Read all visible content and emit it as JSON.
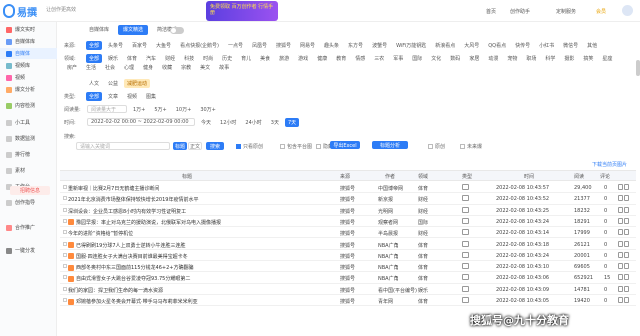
{
  "app": {
    "logo_text": "易撰",
    "tagline": "让创作更高效",
    "banner": "免费领取 百万创作者 行情手册"
  },
  "topnav": [
    {
      "label": "首页"
    },
    {
      "label": "创作助手"
    },
    {
      "label": "定制服务"
    },
    {
      "label": "会员"
    }
  ],
  "sidebar": {
    "items": [
      {
        "label": "爆文实时",
        "icon": "fire-icon"
      },
      {
        "label": "自媒体库",
        "icon": "db-icon"
      },
      {
        "label": "自媒体",
        "icon": "media-icon"
      },
      {
        "label": "视频库",
        "icon": "video-icon"
      },
      {
        "label": "视频",
        "icon": "play-icon"
      },
      {
        "label": "爆文分析",
        "icon": "chart-icon"
      },
      {
        "label": "内容检测",
        "icon": "check-icon"
      },
      {
        "label": "小工具",
        "icon": "tool-icon"
      },
      {
        "label": "数据监测",
        "icon": "monitor-icon"
      },
      {
        "label": "排行榜",
        "icon": "rank-icon"
      },
      {
        "label": "素材",
        "icon": "asset-icon"
      },
      {
        "label": "工作台",
        "icon": "desk-icon"
      },
      {
        "label": "创作指导",
        "icon": "guide-icon"
      },
      {
        "label": "合作推广",
        "icon": "promo-icon"
      },
      {
        "label": "一键分发",
        "icon": "send-icon"
      }
    ],
    "cta": "招聘信息"
  },
  "tabs": [
    {
      "label": "自媒体库"
    },
    {
      "label": "爆文精选"
    }
  ],
  "toggle_label": "简洁模式",
  "filters": {
    "source": {
      "label": "来源:",
      "chips": [
        "全部",
        "头条号",
        "百家号",
        "大鱼号",
        "看点快报(企鹅号)",
        "一点号",
        "凤凰号",
        "搜狐号",
        "网易号",
        "趣头条",
        "东方号",
        "波蟹号",
        "WiFi万能钥匙",
        "新浪看点",
        "大风号",
        "QQ看点",
        "快传号",
        "小红书",
        "微信号",
        "其他"
      ]
    },
    "domain": {
      "label": "领域:",
      "chips": [
        "全部",
        "娱乐",
        "体育",
        "汽车",
        "财经",
        "科技",
        "时尚",
        "历史",
        "育儿",
        "美食",
        "旅游",
        "游戏",
        "健康",
        "教育",
        "情感",
        "三农",
        "军事",
        "国际",
        "文化",
        "数码",
        "家居",
        "动漫",
        "宠物",
        "职场",
        "科学",
        "摄影",
        "搞笑",
        "星座",
        "房产",
        "生活",
        "社会",
        "心理",
        "健身",
        "收藏",
        "宗教",
        "美文",
        "故事"
      ]
    },
    "domain2": {
      "chips": [
        "人文",
        "公益",
        "减肥运动"
      ]
    },
    "media": {
      "label": "类型:",
      "chips": [
        "全部",
        "文章",
        "视频",
        "图集"
      ]
    },
    "read": {
      "label": "阅读量:",
      "placeholder": "阅读量大于",
      "chips": [
        "1万+",
        "5万+",
        "10万+",
        "30万+"
      ]
    },
    "time": {
      "label": "时间:",
      "from": "2022-02-02 00:00",
      "to": "2022-02-09 00:00",
      "chips": [
        "今天",
        "12小时",
        "24小时",
        "3天",
        "7天"
      ]
    },
    "search": {
      "label": "搜索:",
      "placeholder": "请输入关键词",
      "btn_title": "标题",
      "btn_content": "正文",
      "btn_search": "搜索",
      "opt_tag": "只看原创",
      "opt_pub": "包含平台图",
      "opt_hide": "隐藏已读",
      "export": "导出Excel",
      "analyze": "标题分析",
      "opt_1": "原创",
      "opt_2": "未来爆"
    }
  },
  "table": {
    "headers": [
      "标题",
      "来源",
      "作者",
      "领域",
      "类型",
      "时间",
      "阅读",
      "评论"
    ],
    "download": "下载当前页图片",
    "rows": [
      {
        "title": "重新审视｜比赛2月7日无鹤塘主播诊断间",
        "src": "搜狐号",
        "author": "中国博帝网",
        "field": "体育",
        "time": "2022-02-08 10:43:57",
        "read": "29,400",
        "cmt": "0"
      },
      {
        "title": "2021年北京消费市场整体保持较快增长2019年疫情前水平",
        "src": "搜狐号",
        "author": "新京报",
        "field": "财经",
        "time": "2022-02-08 10:43:52",
        "read": "21377",
        "cmt": "0"
      },
      {
        "title": "深圳设会：企业员工感恩8小时内有效学习性证明复工",
        "src": "搜狐号",
        "author": "光明网",
        "field": "财经",
        "time": "2022-02-08 10:43:25",
        "read": "18232",
        "cmt": "0"
      },
      {
        "title": "豫园早报：率止对乌克兰的援助演说，北俄联军对乌电入摄像播报",
        "src": "搜狐号",
        "author": "观察者网",
        "field": "国际",
        "time": "2022-02-08 10:43:24",
        "read": "18291",
        "cmt": "0"
      },
      {
        "title": "今年的进阶“资格给”暂停机位",
        "src": "搜狐号",
        "author": "半岛晨报",
        "field": "财经",
        "time": "2022-02-08 10:43:14",
        "read": "17999",
        "cmt": "0"
      },
      {
        "title": "已得刷刷19分球7人上双勇士逆转小牛连胜三连胜",
        "src": "搜狐号",
        "author": "NBA广角",
        "field": "体育",
        "time": "2022-02-08 10:43:18",
        "read": "26121",
        "cmt": "0"
      },
      {
        "title": "国服·四连胜女子大满台决赛目前谁最美得宝超卡冬",
        "src": "搜狐号",
        "author": "NBA广角",
        "field": "体育",
        "time": "2022-02-08 10:43:24",
        "read": "20001",
        "cmt": "0"
      },
      {
        "title": "西部冬奥村中东三国面前115分钱龙46+2+方确翻骗",
        "src": "搜狐号",
        "author": "NBA广角",
        "field": "体育",
        "time": "2022-02-08 10:43:10",
        "read": "69605",
        "cmt": "0"
      },
      {
        "title": "自由式滑雪女子大跳台谷爱凌夺冠93.75分耀眼第二",
        "src": "搜狐号",
        "author": "NBA广角",
        "field": "体育",
        "time": "2022-02-08 10:43:06",
        "read": "652921",
        "cmt": "15"
      },
      {
        "title": "我们的家园：捍卫我们生命的每一滴水资源",
        "src": "搜狐号",
        "author": "看中国(平台编号)",
        "field": "娱乐",
        "time": "2022-02-08 10:43:09",
        "read": "14781",
        "cmt": "0"
      },
      {
        "title": "邓婉蓓参加火星冬奥会开幕式·带手马马布莉菲米米利亚",
        "src": "搜狐号",
        "author": "青年网",
        "field": "体育",
        "time": "2022-02-08 10:43:05",
        "read": "19420",
        "cmt": "0"
      }
    ]
  },
  "watermark": "搜狐号@九十分教育"
}
